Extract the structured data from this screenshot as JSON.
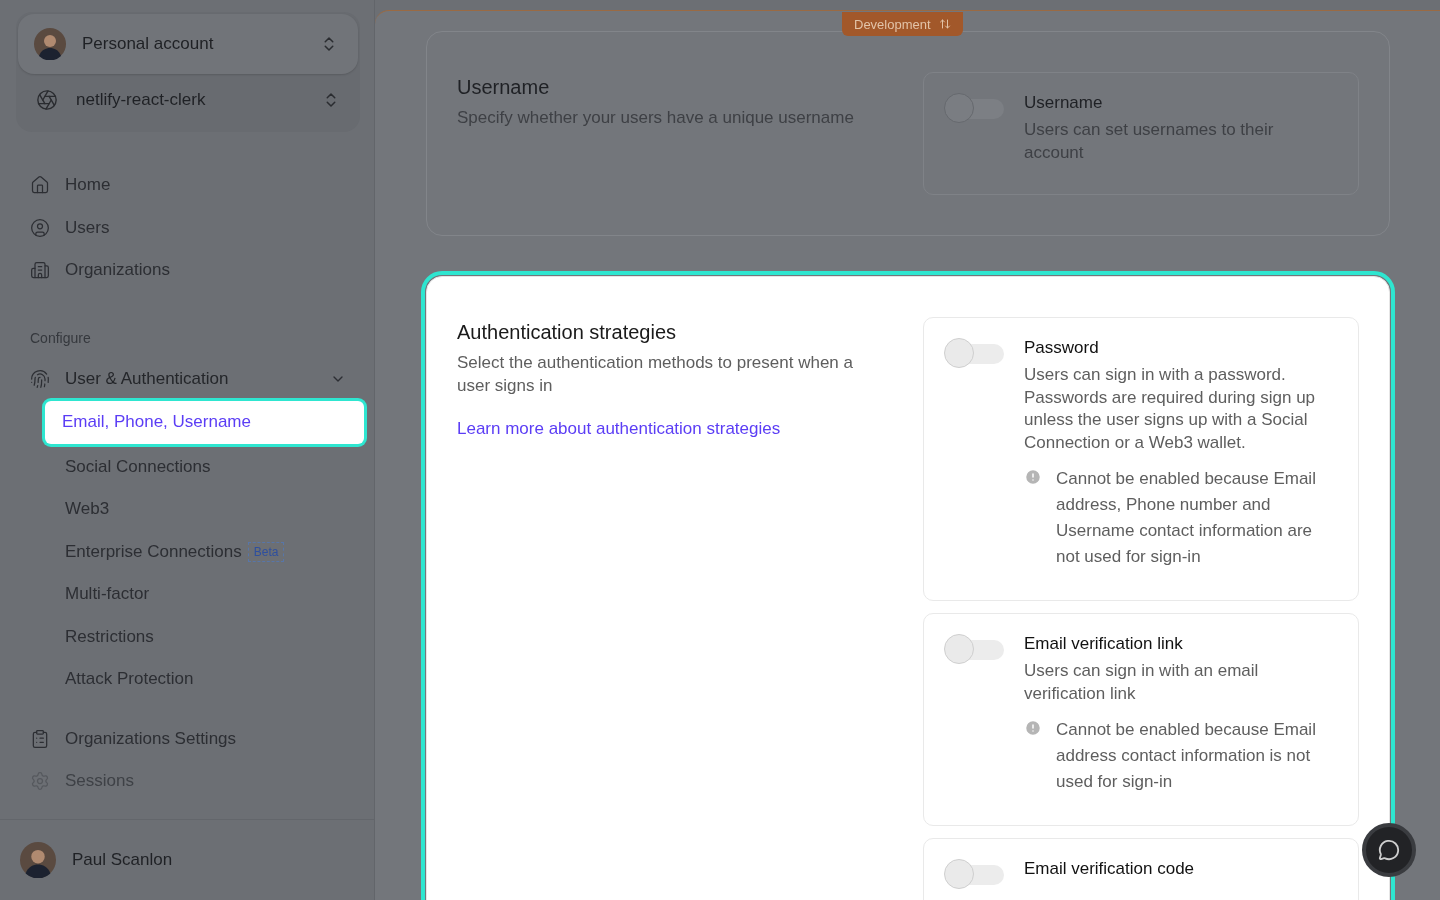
{
  "workspace": {
    "account": "Personal account",
    "app": "netlify-react-clerk"
  },
  "nav": [
    {
      "label": "Home"
    },
    {
      "label": "Users"
    },
    {
      "label": "Organizations"
    }
  ],
  "configure": {
    "heading": "Configure",
    "group": {
      "label": "User & Authentication",
      "expanded": true,
      "children": [
        {
          "label": "Email, Phone, Username",
          "selected": true
        },
        {
          "label": "Social Connections",
          "selected": false
        },
        {
          "label": "Web3",
          "selected": false
        },
        {
          "label": "Enterprise Connections",
          "badge": "Beta",
          "selected": false
        },
        {
          "label": "Multi-factor",
          "selected": false
        },
        {
          "label": "Restrictions",
          "selected": false
        },
        {
          "label": "Attack Protection",
          "selected": false
        }
      ]
    },
    "items": [
      {
        "label": "Organizations Settings",
        "disabled": false
      },
      {
        "label": "Sessions",
        "disabled": true
      }
    ]
  },
  "user": {
    "name": "Paul Scanlon"
  },
  "environment_badge": "Development",
  "sections": [
    {
      "title": "Username",
      "description": "Specify whether your users have a unique username",
      "highlighted": false,
      "options": [
        {
          "title": "Username",
          "description": "Users can set usernames to their account",
          "on": false
        }
      ]
    },
    {
      "title": "Authentication strategies",
      "description": "Select the authentication methods to present when a user signs in",
      "link": "Learn more about authentication strategies",
      "highlighted": true,
      "options": [
        {
          "title": "Password",
          "description": "Users can sign in with a password. Passwords are required during sign up unless the user signs up with a Social Connection or a Web3 wallet.",
          "warning": "Cannot be enabled because Email address, Phone number and Username contact information are not used for sign-in",
          "on": false
        },
        {
          "title": "Email verification link",
          "description": "Users can sign in with an email verification link",
          "warning": "Cannot be enabled because Email address contact information is not used for sign-in",
          "on": false
        },
        {
          "title": "Email verification code",
          "on": false
        }
      ]
    }
  ]
}
